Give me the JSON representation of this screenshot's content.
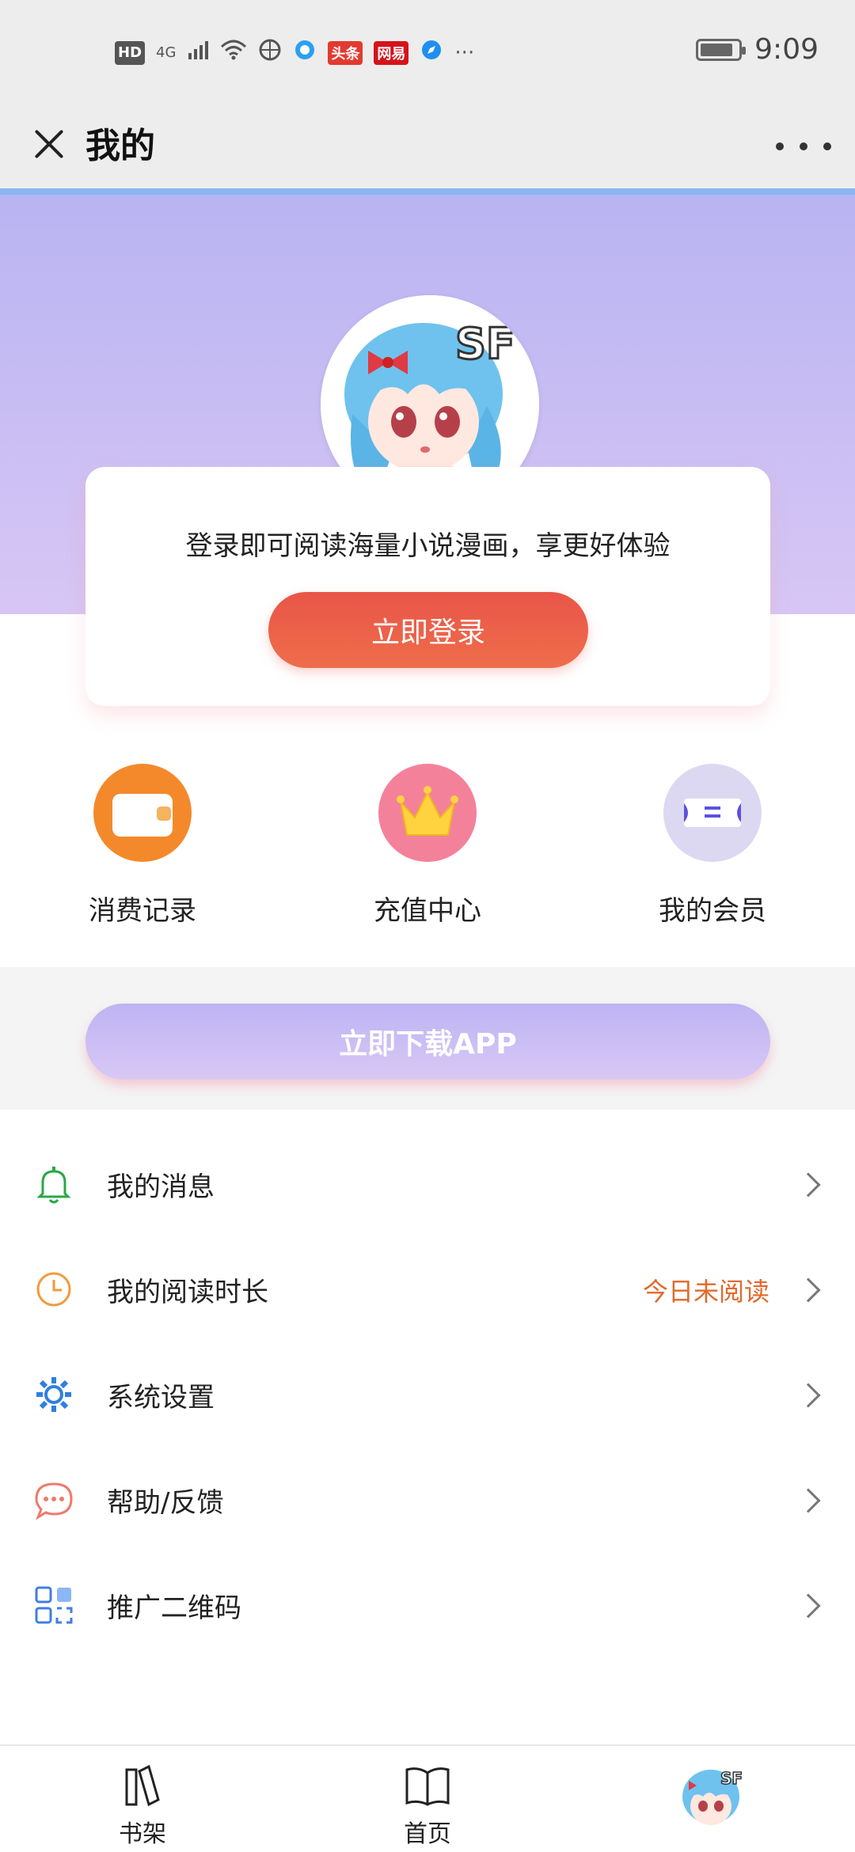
{
  "status": {
    "time": "9:09",
    "signal_labels": [
      "HD",
      "4G"
    ],
    "more": "···",
    "badge_toutiao": "头条",
    "badge_netease": "网易"
  },
  "titlebar": {
    "title": "我的"
  },
  "login": {
    "prompt": "登录即可阅读海量小说漫画，享更好体验",
    "button": "立即登录"
  },
  "quick_actions": [
    {
      "label": "消费记录",
      "icon": "wallet-icon",
      "color": "#f4892c"
    },
    {
      "label": "充值中心",
      "icon": "crown-icon",
      "color": "#f4819a"
    },
    {
      "label": "我的会员",
      "icon": "member-card-icon",
      "color": "#d4d0ef"
    }
  ],
  "download": {
    "button": "立即下载APP"
  },
  "menu": [
    {
      "label": "我的消息",
      "icon": "bell-icon"
    },
    {
      "label": "我的阅读时长",
      "icon": "clock-icon",
      "status": "今日未阅读"
    },
    {
      "label": "系统设置",
      "icon": "gear-icon"
    },
    {
      "label": "帮助/反馈",
      "icon": "chat-icon"
    },
    {
      "label": "推广二维码",
      "icon": "qr-code-icon"
    }
  ],
  "bottom_nav": [
    {
      "label": "书架",
      "icon": "bookshelf-icon"
    },
    {
      "label": "首页",
      "icon": "book-icon"
    },
    {
      "label": "",
      "icon": "profile-avatar-icon"
    }
  ],
  "colors": {
    "accent_blue": "#8ab7f0",
    "hero_top": "#b9b4f2",
    "hero_bottom": "#d7c6f4",
    "login_red": "#e85548",
    "status_orange": "#e06a2b"
  }
}
